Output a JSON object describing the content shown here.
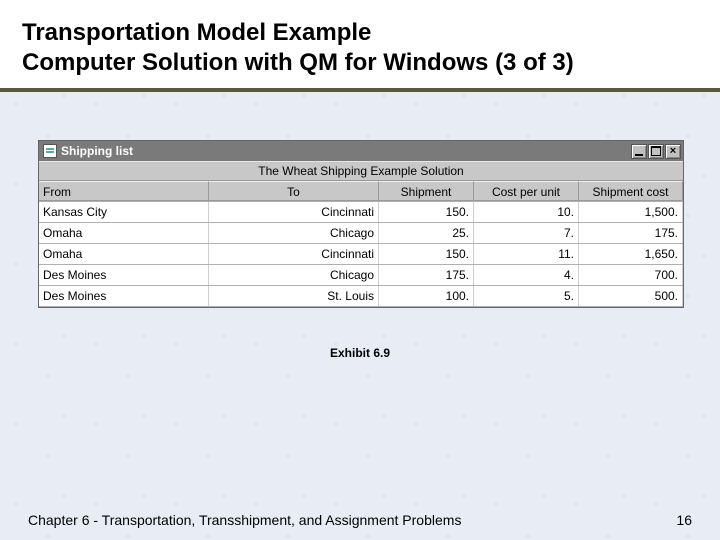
{
  "title_line1": "Transportation Model Example",
  "title_line2": "Computer Solution with QM for Windows (3 of 3)",
  "window": {
    "title": "Shipping list",
    "caption": "The Wheat Shipping Example Solution",
    "headers": {
      "from": "From",
      "to": "To",
      "shipment": "Shipment",
      "cost_per_unit": "Cost per unit",
      "shipment_cost": "Shipment cost"
    },
    "rows": [
      {
        "from": "Kansas City",
        "to": "Cincinnati",
        "shipment": "150.",
        "cost_per_unit": "10.",
        "shipment_cost": "1,500."
      },
      {
        "from": "Omaha",
        "to": "Chicago",
        "shipment": "25.",
        "cost_per_unit": "7.",
        "shipment_cost": "175."
      },
      {
        "from": "Omaha",
        "to": "Cincinnati",
        "shipment": "150.",
        "cost_per_unit": "11.",
        "shipment_cost": "1,650."
      },
      {
        "from": "Des Moines",
        "to": "Chicago",
        "shipment": "175.",
        "cost_per_unit": "4.",
        "shipment_cost": "700."
      },
      {
        "from": "Des Moines",
        "to": "St. Louis",
        "shipment": "100.",
        "cost_per_unit": "5.",
        "shipment_cost": "500."
      }
    ]
  },
  "exhibit_label": "Exhibit 6.9",
  "footer_left": "Chapter 6 - Transportation, Transshipment, and Assignment Problems",
  "footer_right": "16",
  "chart_data": {
    "type": "table",
    "title": "The Wheat Shipping Example Solution",
    "columns": [
      "From",
      "To",
      "Shipment",
      "Cost per unit",
      "Shipment cost"
    ],
    "rows": [
      [
        "Kansas City",
        "Cincinnati",
        150,
        10,
        1500
      ],
      [
        "Omaha",
        "Chicago",
        25,
        7,
        175
      ],
      [
        "Omaha",
        "Cincinnati",
        150,
        11,
        1650
      ],
      [
        "Des Moines",
        "Chicago",
        175,
        4,
        700
      ],
      [
        "Des Moines",
        "St. Louis",
        100,
        5,
        500
      ]
    ]
  }
}
